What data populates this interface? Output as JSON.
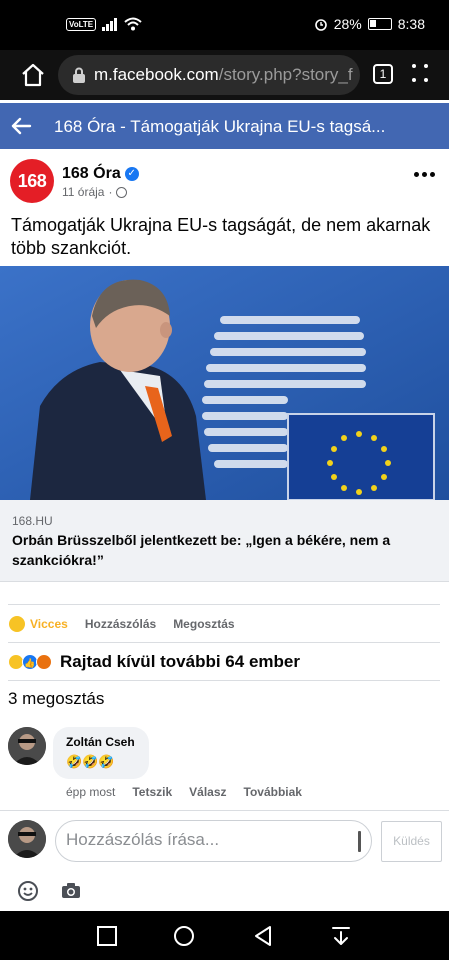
{
  "status": {
    "volte": "VoLTE",
    "battery": "28%",
    "time": "8:38"
  },
  "browser": {
    "url_host": "m.facebook.com",
    "url_path": "/story.php?story_f",
    "tab_count": "1"
  },
  "header": {
    "title": "168 Óra - Támogatják Ukrajna EU-s tagsá..."
  },
  "post": {
    "avatar_text": "168",
    "page_name": "168 Óra",
    "time": "11 órája",
    "separator": "·",
    "text": "Támogatják Ukrajna EU-s tagságát, de nem akarnak több szankciót.",
    "link": {
      "domain": "168.HU",
      "title": "Orbán Brüsszelből jelentkezett be: „Igen a békére, nem a szankciókra!”"
    }
  },
  "actions": {
    "haha_label": "Vicces",
    "comment_label": "Hozzászólás",
    "share_label": "Megosztás"
  },
  "reactions": {
    "summary": "Rajtad kívül további 64 ember"
  },
  "shares": {
    "text": "3 megosztás"
  },
  "comment": {
    "author": "Zoltán Cseh",
    "text": "🤣🤣🤣",
    "time": "épp most",
    "like_label": "Tetszik",
    "reply_label": "Válasz",
    "more_label": "Továbbiak"
  },
  "composer": {
    "placeholder": "Hozzászólás írása...",
    "send_label": "Küldés"
  },
  "colors": {
    "fb_blue": "#4267b2",
    "haha": "#f7b125",
    "brand_red": "#e41e26"
  }
}
